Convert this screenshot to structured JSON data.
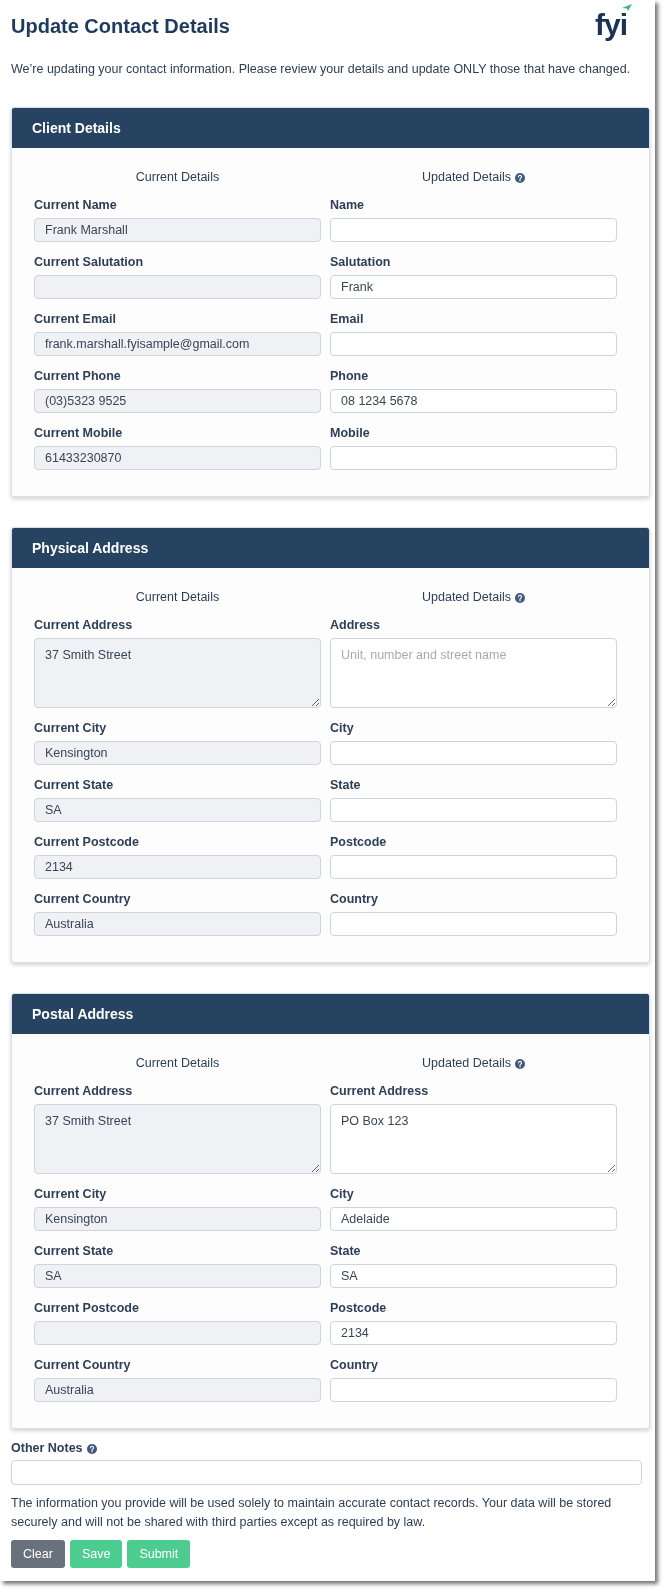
{
  "page": {
    "title": "Update Contact Details",
    "logo": {
      "text": "fyi"
    },
    "intro": "We’re updating your contact information. Please review your details and update ONLY those that have changed."
  },
  "sections": [
    {
      "title": "Client Details",
      "current_heading": "Current Details",
      "updated_heading": "Updated Details",
      "rows": [
        {
          "kind": "input",
          "current_label": "Current Name",
          "current_value": "Frank Marshall",
          "updated_label": "Name"
        },
        {
          "kind": "input",
          "current_label": "Current Salutation",
          "updated_label": "Salutation",
          "updated_value": "Frank"
        },
        {
          "kind": "input",
          "current_label": "Current Email",
          "current_value": "frank.marshall.fyisample@gmail.com",
          "updated_label": "Email"
        },
        {
          "kind": "input",
          "current_label": "Current Phone",
          "current_value": "(03)5323 9525",
          "updated_label": "Phone",
          "updated_value": "08 1234 5678"
        },
        {
          "kind": "input",
          "current_label": "Current Mobile",
          "current_value": "61433230870",
          "updated_label": "Mobile"
        }
      ]
    },
    {
      "title": "Physical Address",
      "current_heading": "Current Details",
      "updated_heading": "Updated Details",
      "rows": [
        {
          "kind": "textarea",
          "current_label": "Current Address",
          "current_value": "37 Smith Street",
          "updated_label": "Address",
          "updated_placeholder": "Unit, number and street name"
        },
        {
          "kind": "input",
          "current_label": "Current City",
          "current_value": "Kensington",
          "updated_label": "City"
        },
        {
          "kind": "input",
          "current_label": "Current State",
          "current_value": "SA",
          "updated_label": "State"
        },
        {
          "kind": "input",
          "current_label": "Current Postcode",
          "current_value": "2134",
          "updated_label": "Postcode"
        },
        {
          "kind": "input",
          "current_label": "Current Country",
          "current_value": "Australia",
          "updated_label": "Country"
        }
      ]
    },
    {
      "title": "Postal Address",
      "current_heading": "Current Details",
      "updated_heading": "Updated Details",
      "rows": [
        {
          "kind": "textarea",
          "current_label": "Current Address",
          "current_value": "37 Smith Street",
          "updated_label": "Current Address",
          "updated_value": "PO Box 123"
        },
        {
          "kind": "input",
          "current_label": "Current City",
          "current_value": "Kensington",
          "updated_label": "City",
          "updated_value": "Adelaide"
        },
        {
          "kind": "input",
          "current_label": "Current State",
          "current_value": "SA",
          "updated_label": "State",
          "updated_value": "SA"
        },
        {
          "kind": "input",
          "current_label": "Current Postcode",
          "updated_label": "Postcode",
          "updated_value": "2134"
        },
        {
          "kind": "input",
          "current_label": "Current Country",
          "current_value": "Australia",
          "updated_label": "Country"
        }
      ]
    }
  ],
  "other_notes": {
    "label": "Other Notes"
  },
  "disclaimer": "The information you provide will be used solely to maintain accurate contact records. Your data will be stored securely and will not be shared with third parties except as required by law.",
  "buttons": [
    {
      "label": "Clear",
      "kind": "secondary"
    },
    {
      "label": "Save",
      "kind": "success"
    },
    {
      "label": "Submit",
      "kind": "success"
    }
  ]
}
